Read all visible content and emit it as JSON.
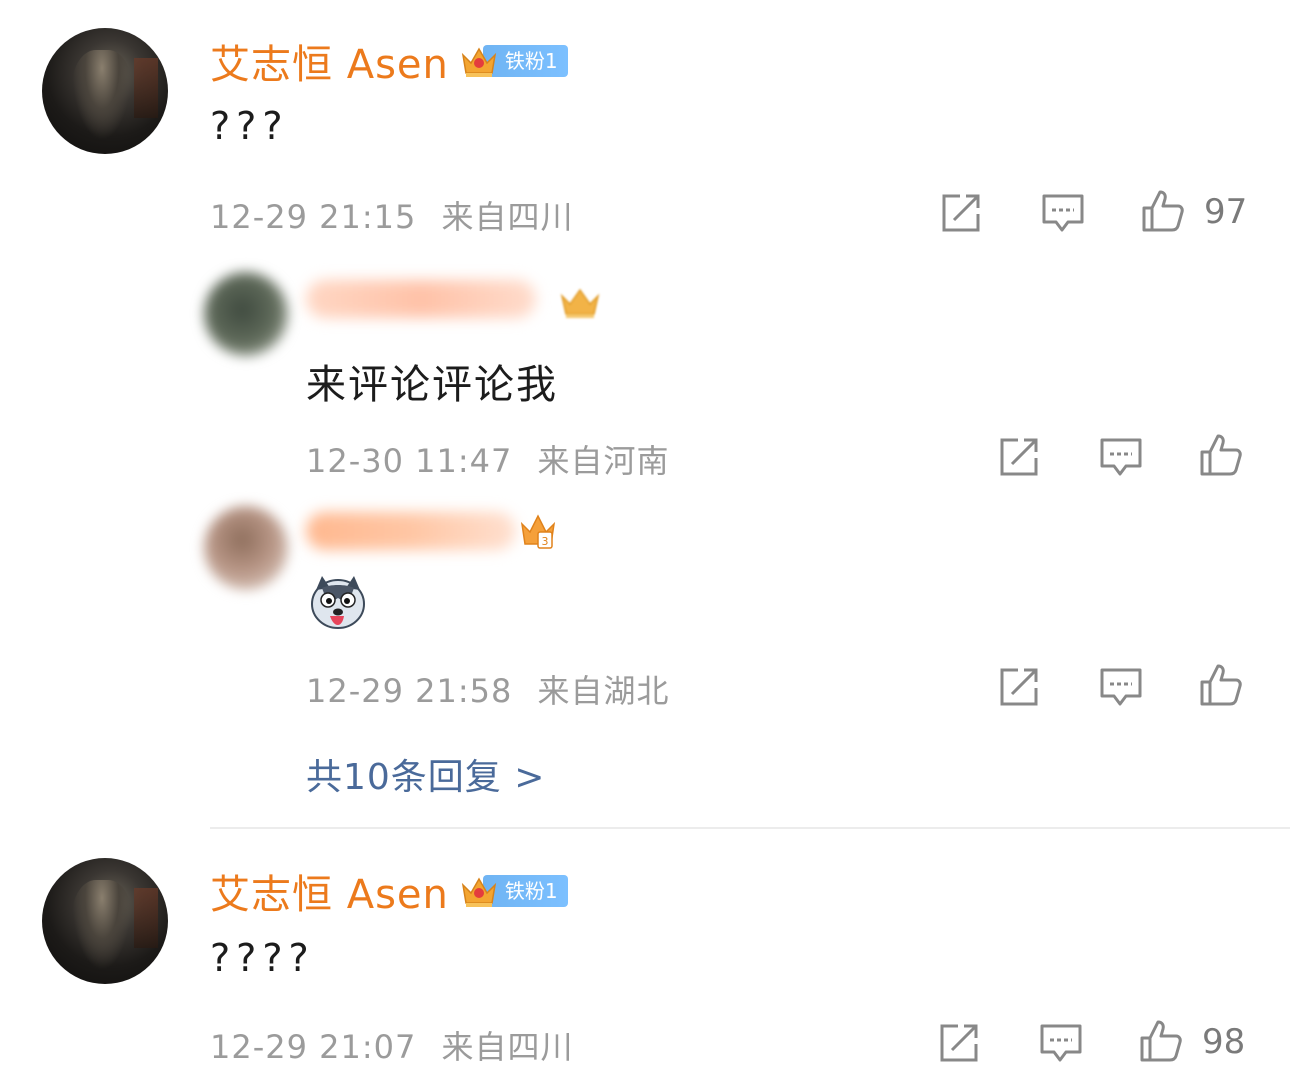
{
  "comments": [
    {
      "username": "艾志恒 Asen",
      "fan_tag": "铁粉1",
      "text": "???",
      "date": "12-29 21:15",
      "location": "来自四川",
      "likes": "97"
    },
    {
      "username": "艾志恒 Asen",
      "fan_tag": "铁粉1",
      "text": "????",
      "date": "12-29 21:07",
      "location": "来自四川",
      "likes": "98"
    }
  ],
  "replies": [
    {
      "text": "来评论评论我",
      "date": "12-30 11:47",
      "location": "来自河南"
    },
    {
      "text": "",
      "emoji": "husky-emoji",
      "date": "12-29 21:58",
      "location": "来自湖北"
    }
  ],
  "more_replies_label": "共10条回复 >",
  "colors": {
    "username": "#ec7a1c",
    "fan_tag": "#6fb4f3",
    "link": "#4a6a9a",
    "meta": "#9b9b9b"
  }
}
